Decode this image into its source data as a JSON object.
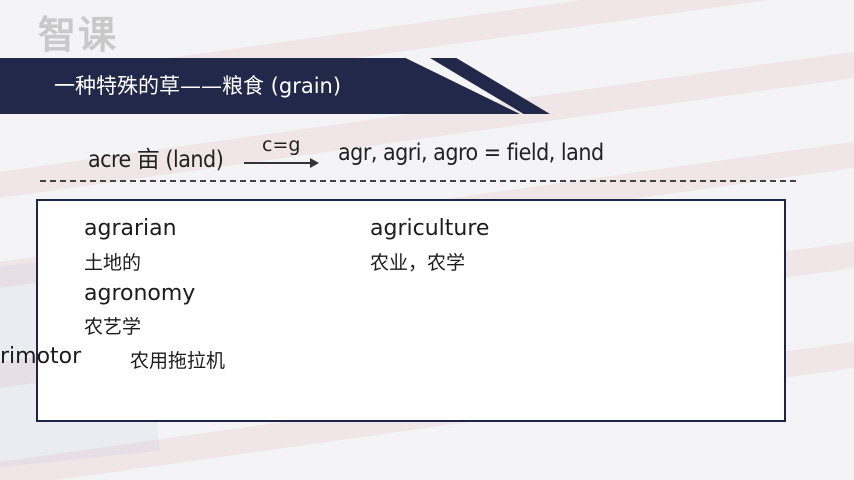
{
  "logo": {
    "text": "智课"
  },
  "banner": {
    "title": "一种特殊的草——粮食 (grain)"
  },
  "formula": {
    "left": "acre 亩 (land)",
    "arrow_label": "c=g",
    "right": "agr, agri, agro = field, land"
  },
  "words": [
    {
      "word": "agrarian",
      "meaning": "土地的"
    },
    {
      "word": "agriculture",
      "meaning": "农业，农学"
    },
    {
      "word": "agronomy",
      "meaning": "农艺学"
    },
    {
      "word": "rimotor",
      "meaning": "农用拖拉机"
    }
  ],
  "colors": {
    "banner": "#22284a",
    "box_border": "#1f2549"
  }
}
